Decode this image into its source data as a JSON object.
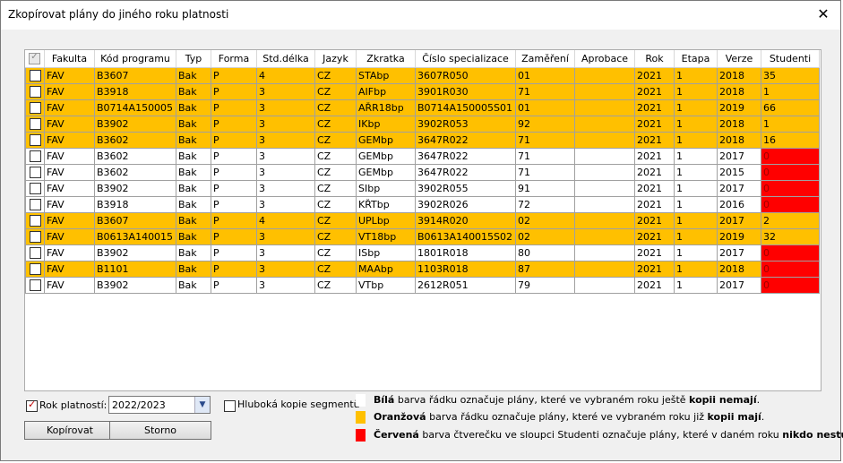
{
  "window": {
    "title": "Zkopírovat plány do jiného roku platnosti",
    "close_glyph": "✕"
  },
  "columns": [
    "Fakulta",
    "Kód programu",
    "Typ",
    "Forma",
    "Std.délka",
    "Jazyk",
    "Zkratka",
    "Číslo specializace",
    "Zaměření",
    "Aprobace",
    "Rok",
    "Etapa",
    "Verze",
    "Studenti"
  ],
  "rows": [
    {
      "color": "orange",
      "red": false,
      "cells": [
        "FAV",
        "B3607",
        "Bak",
        "P",
        "4",
        "CZ",
        "STAbp",
        "3607R050",
        "01",
        "",
        "2021",
        "1",
        "2018",
        "35"
      ]
    },
    {
      "color": "orange",
      "red": false,
      "cells": [
        "FAV",
        "B3918",
        "Bak",
        "P",
        "3",
        "CZ",
        "AIFbp",
        "3901R030",
        "71",
        "",
        "2021",
        "1",
        "2018",
        "1"
      ]
    },
    {
      "color": "orange",
      "red": false,
      "cells": [
        "FAV",
        "B0714A150005",
        "Bak",
        "P",
        "3",
        "CZ",
        "AŘR18bp",
        "B0714A150005S01",
        "01",
        "",
        "2021",
        "1",
        "2019",
        "66"
      ]
    },
    {
      "color": "orange",
      "red": false,
      "cells": [
        "FAV",
        "B3902",
        "Bak",
        "P",
        "3",
        "CZ",
        "IKbp",
        "3902R053",
        "92",
        "",
        "2021",
        "1",
        "2018",
        "1"
      ]
    },
    {
      "color": "orange",
      "red": false,
      "cells": [
        "FAV",
        "B3602",
        "Bak",
        "P",
        "3",
        "CZ",
        "GEMbp",
        "3647R022",
        "71",
        "",
        "2021",
        "1",
        "2018",
        "16"
      ]
    },
    {
      "color": "white",
      "red": true,
      "cells": [
        "FAV",
        "B3602",
        "Bak",
        "P",
        "3",
        "CZ",
        "GEMbp",
        "3647R022",
        "71",
        "",
        "2021",
        "1",
        "2017",
        "0"
      ]
    },
    {
      "color": "white",
      "red": true,
      "cells": [
        "FAV",
        "B3602",
        "Bak",
        "P",
        "3",
        "CZ",
        "GEMbp",
        "3647R022",
        "71",
        "",
        "2021",
        "1",
        "2015",
        "0"
      ]
    },
    {
      "color": "white",
      "red": true,
      "cells": [
        "FAV",
        "B3902",
        "Bak",
        "P",
        "3",
        "CZ",
        "SIbp",
        "3902R055",
        "91",
        "",
        "2021",
        "1",
        "2017",
        "0"
      ]
    },
    {
      "color": "white",
      "red": true,
      "cells": [
        "FAV",
        "B3918",
        "Bak",
        "P",
        "3",
        "CZ",
        "KŘTbp",
        "3902R026",
        "72",
        "",
        "2021",
        "1",
        "2016",
        "0"
      ]
    },
    {
      "color": "orange",
      "red": false,
      "cells": [
        "FAV",
        "B3607",
        "Bak",
        "P",
        "4",
        "CZ",
        "UPLbp",
        "3914R020",
        "02",
        "",
        "2021",
        "1",
        "2017",
        "2"
      ]
    },
    {
      "color": "orange",
      "red": false,
      "cells": [
        "FAV",
        "B0613A140015",
        "Bak",
        "P",
        "3",
        "CZ",
        "VT18bp",
        "B0613A140015S02",
        "02",
        "",
        "2021",
        "1",
        "2019",
        "32"
      ]
    },
    {
      "color": "white",
      "red": true,
      "cells": [
        "FAV",
        "B3902",
        "Bak",
        "P",
        "3",
        "CZ",
        "ISbp",
        "1801R018",
        "80",
        "",
        "2021",
        "1",
        "2017",
        "0"
      ]
    },
    {
      "color": "orange",
      "red": true,
      "cells": [
        "FAV",
        "B1101",
        "Bak",
        "P",
        "3",
        "CZ",
        "MAAbp",
        "1103R018",
        "87",
        "",
        "2021",
        "1",
        "2018",
        "0"
      ]
    },
    {
      "color": "white",
      "red": true,
      "cells": [
        "FAV",
        "B3902",
        "Bak",
        "P",
        "3",
        "CZ",
        "VTbp",
        "2612R051",
        "79",
        "",
        "2021",
        "1",
        "2017",
        "0"
      ]
    }
  ],
  "colors": {
    "orange": "#ffc000",
    "red": "#ff0000",
    "white": "#ffffff"
  },
  "rok_platnosti": {
    "label": "Rok platností:",
    "checked": true,
    "value": "2022/2023"
  },
  "deep_copy": {
    "label": "Hluboká kopie segmentů",
    "checked": false
  },
  "buttons": {
    "copy": "Kopírovat",
    "cancel": "Storno"
  },
  "legend": {
    "white": {
      "strong": "Bílá",
      "text": " barva řádku označuje plány, které ve vybraném roku ještě ",
      "emph": "kopii nemají",
      "end": "."
    },
    "orange": {
      "strong": "Oranžová",
      "text": " barva řádku označuje plány, které ve vybraném roku již ",
      "emph": "kopii mají",
      "end": "."
    },
    "red": {
      "strong": "Červená",
      "text": " barva čtverečku ve sloupci Studenti označuje plány, které v daném roku ",
      "emph": "nikdo nestuduje",
      "end": "."
    }
  }
}
